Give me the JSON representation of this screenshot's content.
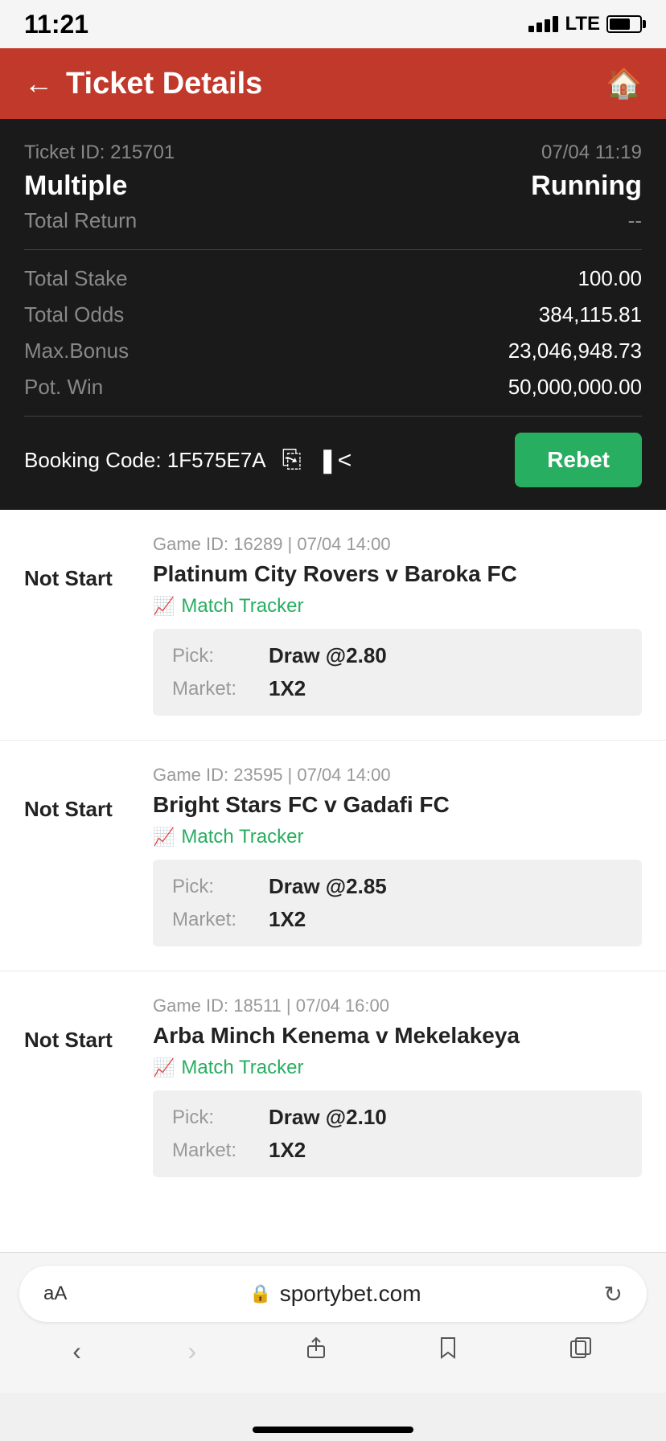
{
  "statusBar": {
    "time": "11:21",
    "lte": "LTE"
  },
  "header": {
    "title": "Ticket Details",
    "backLabel": "←",
    "homeIcon": "🏠"
  },
  "ticket": {
    "id_label": "Ticket ID: 215701",
    "date": "07/04 11:19",
    "type": "Multiple",
    "status": "Running",
    "total_return_label": "Total Return",
    "total_return_value": "--",
    "total_stake_label": "Total Stake",
    "total_stake_value": "100.00",
    "total_odds_label": "Total Odds",
    "total_odds_value": "384,115.81",
    "max_bonus_label": "Max.Bonus",
    "max_bonus_value": "23,046,948.73",
    "pot_win_label": "Pot. Win",
    "pot_win_value": "50,000,000.00",
    "booking_code_label": "Booking Code: 1F575E7A",
    "rebet_label": "Rebet"
  },
  "matches": [
    {
      "status": "Not Start",
      "game_id": "Game ID: 16289 | 07/04 14:00",
      "teams": "Platinum City Rovers v Baroka FC",
      "tracker_label": "Match Tracker",
      "pick_label": "Pick:",
      "pick_value": "Draw @2.80",
      "market_label": "Market:",
      "market_value": "1X2"
    },
    {
      "status": "Not Start",
      "game_id": "Game ID: 23595 | 07/04 14:00",
      "teams": "Bright Stars FC v Gadafi FC",
      "tracker_label": "Match Tracker",
      "pick_label": "Pick:",
      "pick_value": "Draw @2.85",
      "market_label": "Market:",
      "market_value": "1X2"
    },
    {
      "status": "Not Start",
      "game_id": "Game ID: 18511 | 07/04 16:00",
      "teams": "Arba Minch Kenema v Mekelakeya",
      "tracker_label": "Match Tracker",
      "pick_label": "Pick:",
      "pick_value": "Draw @2.10",
      "market_label": "Market:",
      "market_value": "1X2"
    }
  ],
  "browser": {
    "font_size_label": "aA",
    "url": "sportybet.com",
    "lock_icon": "🔒"
  }
}
